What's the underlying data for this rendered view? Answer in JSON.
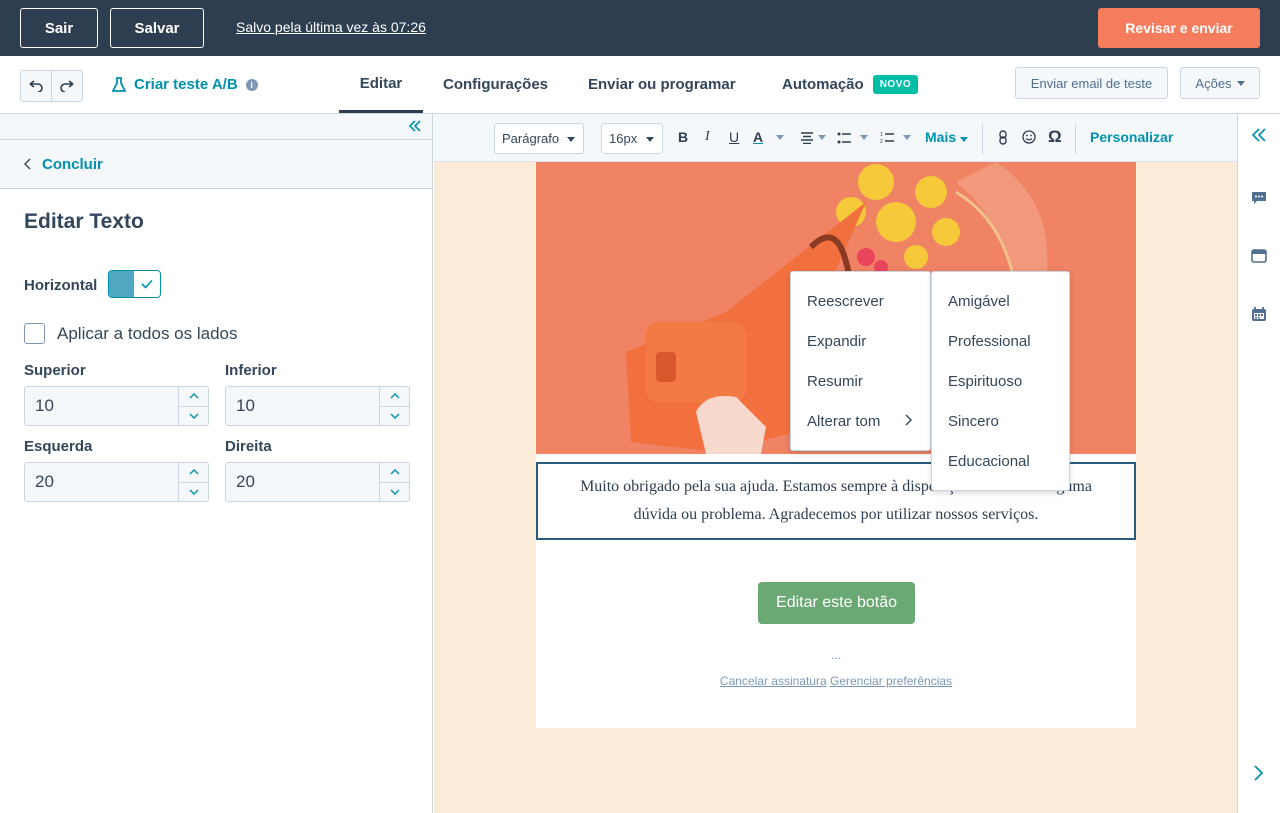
{
  "topbar": {
    "exit_label": "Sair",
    "save_label": "Salvar",
    "saved_status": "Salvo pela última vez às 07:26",
    "review_label": "Revisar e enviar"
  },
  "subnav": {
    "ab_test_label": "Criar teste A/B",
    "tabs": [
      {
        "label": "Editar"
      },
      {
        "label": "Configurações"
      },
      {
        "label": "Enviar ou programar"
      },
      {
        "label": "Automação"
      }
    ],
    "new_badge": "NOVO",
    "test_email_label": "Enviar email de teste",
    "actions_label": "Ações"
  },
  "panel": {
    "back_label": "Concluir",
    "title": "Editar Texto",
    "horizontal_label": "Horizontal",
    "apply_all_label": "Aplicar a todos os lados",
    "fields": [
      {
        "label": "Superior",
        "value": "10"
      },
      {
        "label": "Inferior",
        "value": "10"
      },
      {
        "label": "Esquerda",
        "value": "20"
      },
      {
        "label": "Direita",
        "value": "20"
      }
    ]
  },
  "toolbar": {
    "paragraph_select": "Parágrafo",
    "size_select": "16px",
    "more_label": "Mais",
    "personalize_label": "Personalizar"
  },
  "email": {
    "body_text": "Muito obrigado pela sua ajuda. Estamos sempre à disposição caso tenha alguma dúvida ou problema. Agradecemos por utilizar nossos serviços.",
    "button_label": "Editar este botão",
    "footer_dots": "...",
    "unsubscribe_label": "Cancelar assinatura",
    "preferences_label": "Gerenciar preferências"
  },
  "ai_menu": {
    "items": [
      "Reescrever",
      "Expandir",
      "Resumir",
      "Alterar tom"
    ],
    "tones": [
      "Amigável",
      "Professional",
      "Espirituoso",
      "Sincero",
      "Educacional"
    ]
  },
  "colors": {
    "topbar_bg": "#2d3e50",
    "accent_orange": "#f57d5e",
    "link_teal": "#0091ae",
    "canvas_bg": "#fbebd9",
    "cta_green": "#6aa874"
  }
}
